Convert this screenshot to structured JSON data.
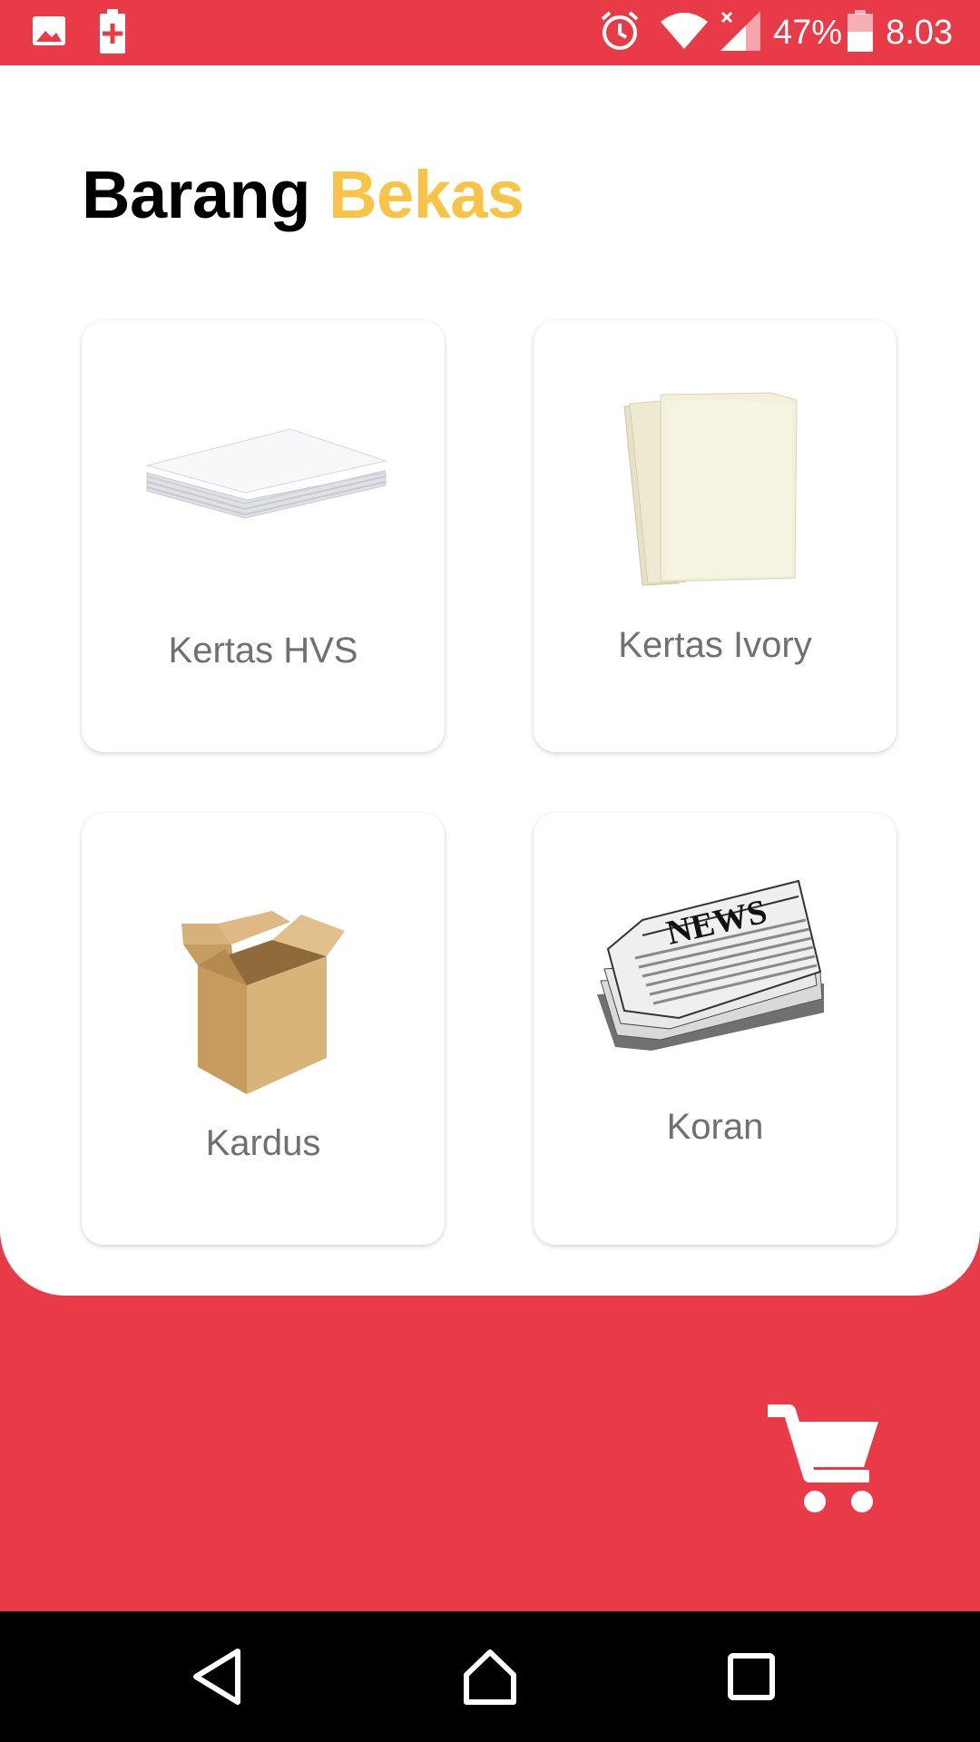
{
  "status_bar": {
    "battery_percent": "47%",
    "time": "8.03",
    "icons": [
      "image-icon",
      "battery-saver-icon",
      "alarm-icon",
      "wifi-icon",
      "signal-icon",
      "battery-icon"
    ]
  },
  "header": {
    "title_word1": "Barang",
    "title_word2": "Bekas"
  },
  "colors": {
    "primary_red": "#e93a47",
    "accent_yellow": "#f7c447",
    "label_gray": "#707070"
  },
  "items": [
    {
      "label": "Kertas HVS",
      "icon": "paper-stack-icon"
    },
    {
      "label": "Kertas Ivory",
      "icon": "ivory-paper-icon"
    },
    {
      "label": "Kardus",
      "icon": "cardboard-box-icon"
    },
    {
      "label": "Koran",
      "icon": "newspaper-icon"
    }
  ],
  "newspaper_headline": "NEWS",
  "fab": {
    "icon": "cart-icon"
  },
  "nav": {
    "icons": [
      "back-icon",
      "home-icon",
      "recents-icon"
    ]
  }
}
